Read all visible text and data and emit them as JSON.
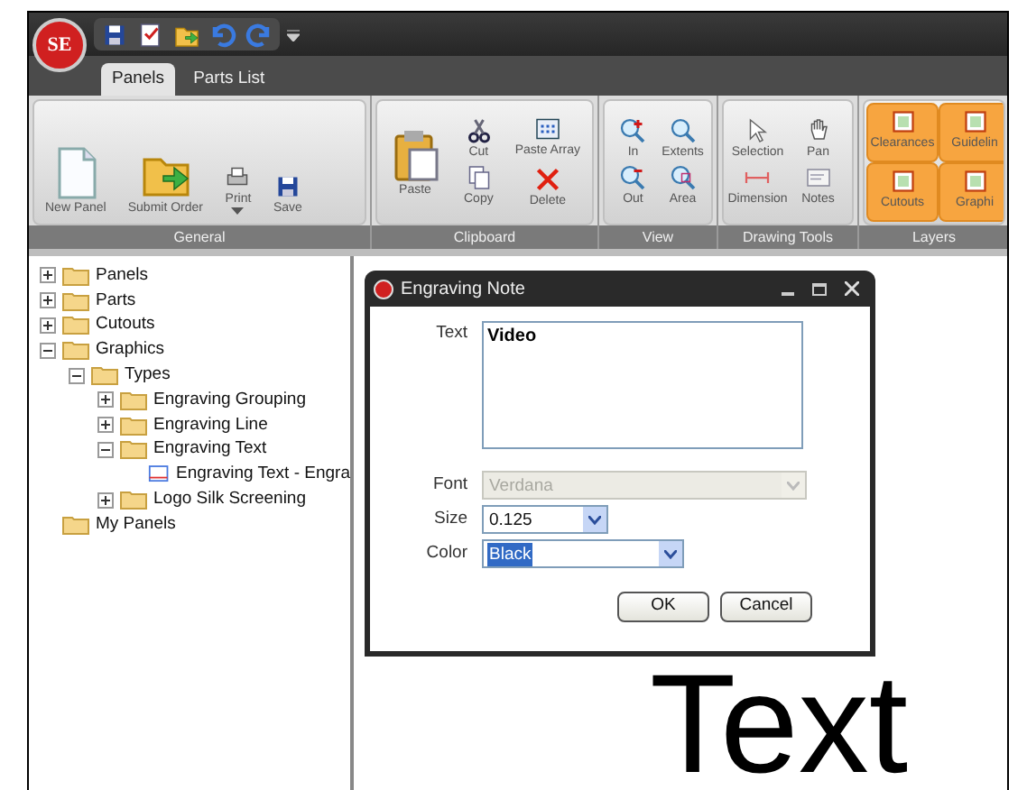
{
  "app_logo": {
    "text": "SE"
  },
  "tabs": [
    {
      "label": "Panels",
      "selected": true
    },
    {
      "label": "Parts List",
      "selected": false
    }
  ],
  "ribbon": {
    "groups": [
      {
        "label": "General",
        "buttons": [
          {
            "kind": "new-doc",
            "label": "New Panel"
          },
          {
            "kind": "folder-arrow",
            "label": "Submit Order"
          },
          {
            "kind": "printer",
            "label": "Print",
            "dropdown": true
          },
          {
            "kind": "floppy",
            "label": "Save"
          }
        ]
      },
      {
        "label": "Clipboard",
        "buttons": [
          {
            "kind": "clipboard",
            "label": "Paste"
          },
          {
            "kind": "scissors",
            "label": "Cut"
          },
          {
            "kind": "copy",
            "label": "Copy"
          },
          {
            "kind": "grid",
            "label": "Paste Array"
          },
          {
            "kind": "x-mark",
            "label": "Delete"
          }
        ]
      },
      {
        "label": "View",
        "buttons": [
          {
            "kind": "zoom-in",
            "label": "In"
          },
          {
            "kind": "zoom",
            "label": "Extents"
          },
          {
            "kind": "zoom-out",
            "label": "Out"
          },
          {
            "kind": "zoom-area",
            "label": "Area"
          }
        ]
      },
      {
        "label": "Drawing Tools",
        "buttons": [
          {
            "kind": "pointer",
            "label": "Selection"
          },
          {
            "kind": "hand",
            "label": "Pan"
          },
          {
            "kind": "dimension",
            "label": "Dimension"
          },
          {
            "kind": "note",
            "label": "Notes"
          }
        ]
      },
      {
        "label": "Layers",
        "buttons": [
          {
            "kind": "layer",
            "label": "Clearances",
            "on": true
          },
          {
            "kind": "layer",
            "label": "Guidelin",
            "on": true
          },
          {
            "kind": "layer",
            "label": "Cutouts",
            "on": true
          },
          {
            "kind": "layer",
            "label": "Graphi",
            "on": true
          }
        ]
      }
    ]
  },
  "tree": [
    {
      "label": "Panels",
      "kind": "folder",
      "expanded": false
    },
    {
      "label": "Parts",
      "kind": "folder",
      "expanded": false
    },
    {
      "label": "Cutouts",
      "kind": "folder",
      "expanded": false
    },
    {
      "label": "Graphics",
      "kind": "folder",
      "expanded": true,
      "children": [
        {
          "label": "Types",
          "kind": "folder",
          "expanded": true,
          "children": [
            {
              "label": "Engraving Grouping",
              "kind": "folder",
              "expanded": false
            },
            {
              "label": "Engraving Line",
              "kind": "folder",
              "expanded": false
            },
            {
              "label": "Engraving Text",
              "kind": "folder",
              "expanded": true,
              "children": [
                {
                  "label": "Engraving Text - Engra",
                  "kind": "item"
                }
              ]
            },
            {
              "label": "Logo Silk Screening",
              "kind": "folder",
              "expanded": false
            }
          ]
        }
      ]
    },
    {
      "label": "My Panels",
      "kind": "folder"
    }
  ],
  "dialog": {
    "title": "Engraving Note",
    "text": {
      "label": "Text",
      "value": "Video"
    },
    "font": {
      "label": "Font",
      "value": "Verdana",
      "disabled": true
    },
    "size": {
      "label": "Size",
      "value": "0.125"
    },
    "color": {
      "label": "Color",
      "value": "Black",
      "highlighted": true
    },
    "buttons": [
      "OK",
      "Cancel"
    ]
  },
  "canvas": {
    "text": "Text"
  }
}
